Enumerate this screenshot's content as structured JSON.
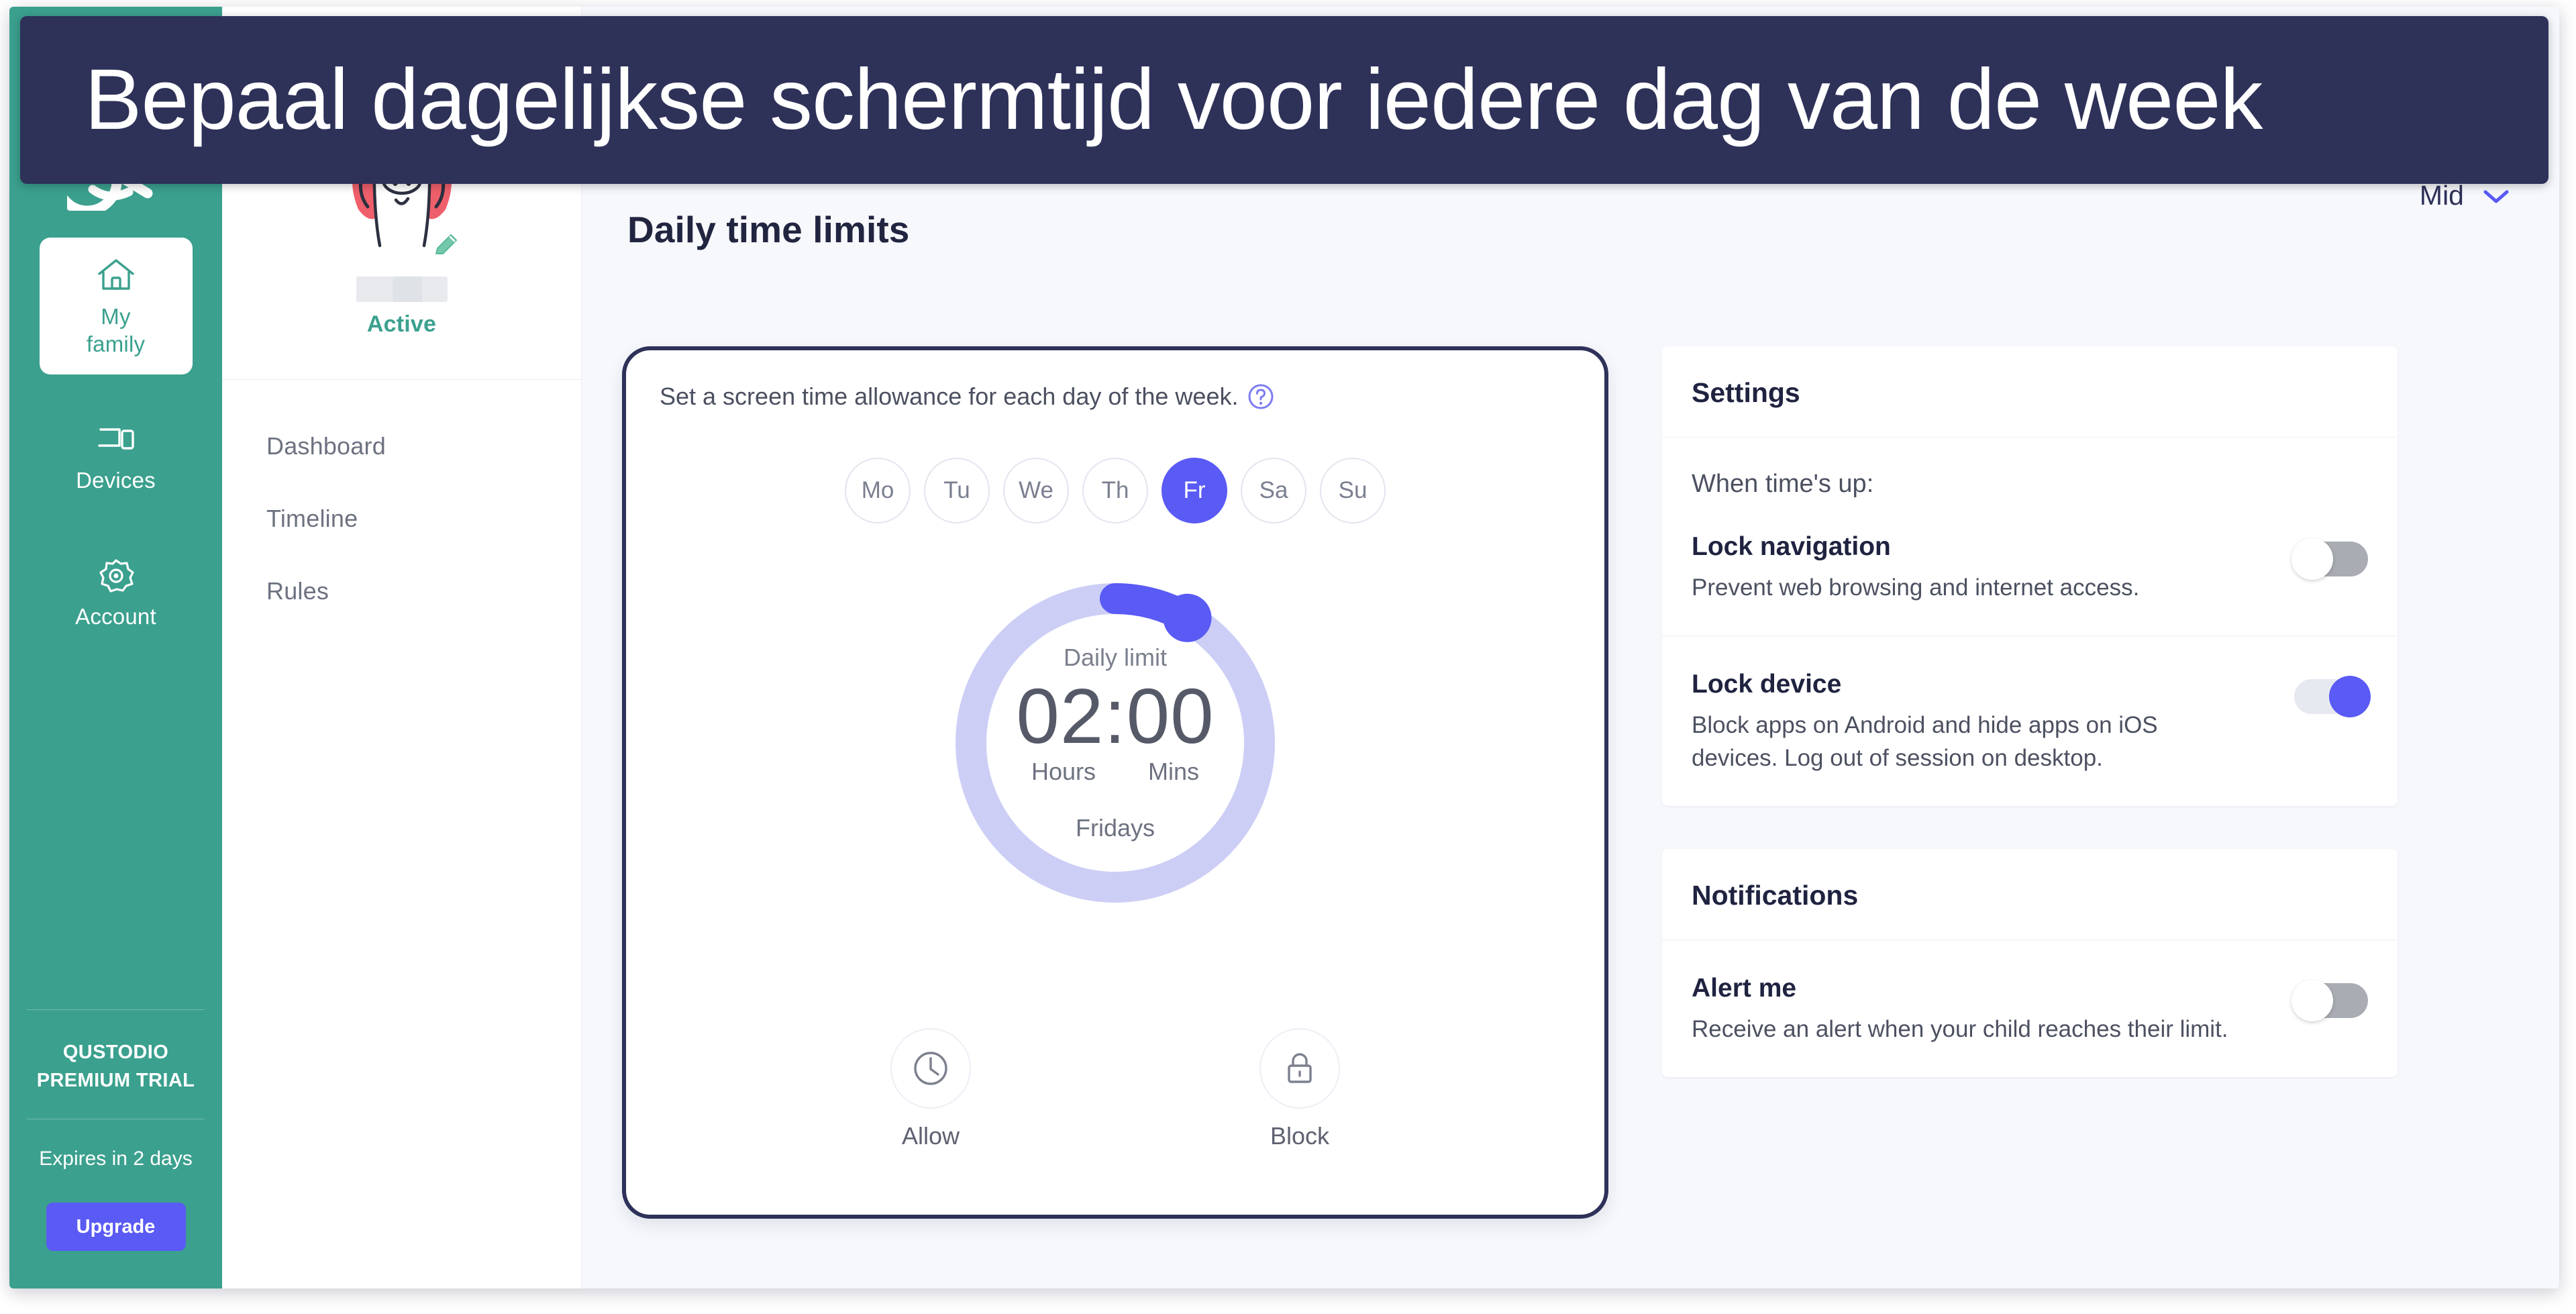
{
  "banner": {
    "text": "Bepaal dagelijkse schermtijd voor iedere dag van de week",
    "bg_color": "#2e3158"
  },
  "sidebar": {
    "brand_icon": "qustodio-logo-icon",
    "accent_color": "#3ba08e",
    "items": [
      {
        "label": "My\nfamily",
        "icon": "home-icon",
        "active": true
      },
      {
        "label": "Devices",
        "icon": "devices-icon",
        "active": false
      },
      {
        "label": "Account",
        "icon": "gear-icon",
        "active": false
      }
    ],
    "trial": {
      "title": "QUSTODIO PREMIUM TRIAL",
      "expiry": "Expires in 2 days",
      "upgrade_label": "Upgrade",
      "upgrade_color": "#5a5af5"
    }
  },
  "child_panel": {
    "avatar_icon": "pig-avatar-icon",
    "edit_icon": "pencil-icon",
    "name": "",
    "status": "Active",
    "status_color": "#3ba08e",
    "nav": [
      {
        "label": "Dashboard"
      },
      {
        "label": "Timeline"
      },
      {
        "label": "Rules"
      }
    ]
  },
  "topbar": {
    "selected_value": "Mid",
    "chevron_icon": "chevron-down-icon",
    "chevron_color": "#5a5af5"
  },
  "main": {
    "page_title": "Daily time limits",
    "limits_card": {
      "description": "Set a screen time allowance for each day of the week.",
      "help_icon": "question-circle-icon",
      "days": [
        {
          "label": "Mo",
          "selected": false
        },
        {
          "label": "Tu",
          "selected": false
        },
        {
          "label": "We",
          "selected": false
        },
        {
          "label": "Th",
          "selected": false
        },
        {
          "label": "Fr",
          "selected": true
        },
        {
          "label": "Sa",
          "selected": false
        },
        {
          "label": "Su",
          "selected": false
        }
      ],
      "dial": {
        "label": "Daily limit",
        "time": "02:00",
        "unit_hours": "Hours",
        "unit_mins": "Mins",
        "day_name": "Fridays",
        "track_color": "#cdcef6",
        "progress_color": "#5a5af5",
        "progress_hours": 2,
        "progress_of_hours": 24
      },
      "actions": [
        {
          "label": "Allow",
          "icon": "clock-icon"
        },
        {
          "label": "Block",
          "icon": "lock-icon"
        }
      ]
    }
  },
  "settings_panel": {
    "header": "Settings",
    "subtitle": "When time's up:",
    "rows": [
      {
        "title": "Lock navigation",
        "desc": "Prevent web browsing and internet access.",
        "enabled": false
      },
      {
        "title": "Lock device",
        "desc": "Block apps on Android and hide apps on iOS devices. Log out of session on desktop.",
        "enabled": true
      }
    ]
  },
  "notifications_panel": {
    "header": "Notifications",
    "rows": [
      {
        "title": "Alert me",
        "desc": "Receive an alert when your child reaches their limit.",
        "enabled": false
      }
    ]
  }
}
